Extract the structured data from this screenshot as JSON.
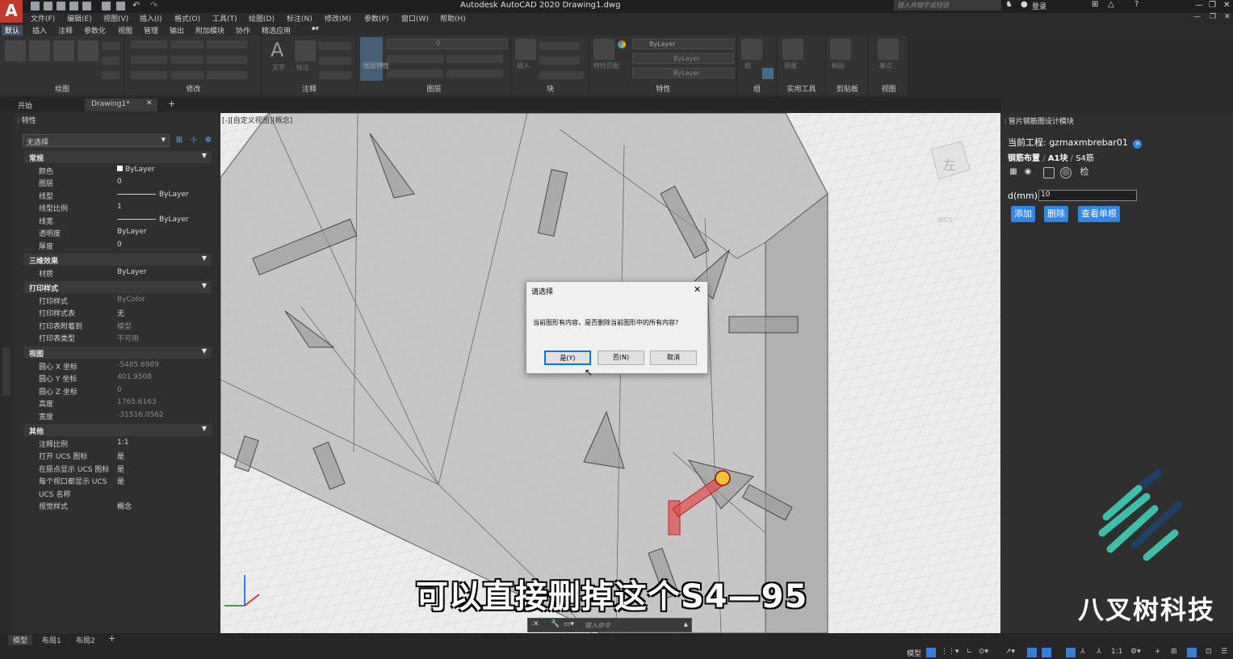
{
  "app": {
    "logo": "A",
    "title": "Autodesk AutoCAD 2020   Drawing1.dwg",
    "search_placeholder": "键入关键字或短语",
    "login": "登录"
  },
  "menus": [
    "文件(F)",
    "编辑(E)",
    "视图(V)",
    "插入(I)",
    "格式(O)",
    "工具(T)",
    "绘图(D)",
    "标注(N)",
    "修改(M)",
    "参数(P)",
    "窗口(W)",
    "帮助(H)"
  ],
  "ribbon_tabs": [
    "默认",
    "插入",
    "注释",
    "参数化",
    "视图",
    "管理",
    "输出",
    "附加模块",
    "协作",
    "精选应用"
  ],
  "ribbon_panels": [
    "绘图",
    "修改",
    "注释",
    "图层",
    "块",
    "特性",
    "组",
    "实用工具",
    "剪贴板",
    "视图"
  ],
  "ribbon_small": {
    "layer_value": "0",
    "bylayer1": "ByLayer",
    "bylayer2": "ByLayer",
    "bylayer3": "ByLayer",
    "text": "文字",
    "dim": "标注",
    "match": "特性匹配",
    "layerprop": "图层特性",
    "insert": "插入",
    "measure": "测量",
    "paste": "粘贴",
    "base": "基点",
    "group": "组"
  },
  "doc_tabs": {
    "start": "开始",
    "drawing": "Drawing1*",
    "close": "✕",
    "add": "+"
  },
  "properties": {
    "title": "特性",
    "selection": "无选择",
    "sections": {
      "general": {
        "title": "常规",
        "rows": [
          [
            "颜色",
            "ByLayer"
          ],
          [
            "图层",
            "0"
          ],
          [
            "线型",
            "ByLayer"
          ],
          [
            "线型比例",
            "1"
          ],
          [
            "线宽",
            "ByLayer"
          ],
          [
            "透明度",
            "ByLayer"
          ],
          [
            "厚度",
            "0"
          ]
        ]
      },
      "effects3d": {
        "title": "三维效果",
        "rows": [
          [
            "材质",
            "ByLayer"
          ]
        ]
      },
      "plotstyle": {
        "title": "打印样式",
        "rows": [
          [
            "打印样式",
            "ByColor"
          ],
          [
            "打印样式表",
            "无"
          ],
          [
            "打印表附着到",
            "模型"
          ],
          [
            "打印表类型",
            "不可用"
          ]
        ]
      },
      "view": {
        "title": "视图",
        "rows": [
          [
            "圆心 X 坐标",
            "-5485.6989"
          ],
          [
            "圆心 Y 坐标",
            "401.9508"
          ],
          [
            "圆心 Z 坐标",
            "0"
          ],
          [
            "高度",
            "1765.6163"
          ],
          [
            "宽度",
            "-31516.0562"
          ]
        ]
      },
      "misc": {
        "title": "其他",
        "rows": [
          [
            "注释比例",
            "1:1"
          ],
          [
            "打开 UCS 图标",
            "是"
          ],
          [
            "在原点显示 UCS 图标",
            "是"
          ],
          [
            "每个视口都显示 UCS",
            "是"
          ],
          [
            "UCS 名称",
            ""
          ],
          [
            "视觉样式",
            "概念"
          ]
        ]
      }
    }
  },
  "viewport": {
    "label": "[-][自定义视图][概念]",
    "viewcube": "左",
    "wcs": "WCS"
  },
  "right_panel": {
    "title": "管片钢筋图设计模块",
    "project_label": "当前工程: gzmaxmbrebar01",
    "crumbs": [
      "钢筋布置",
      "A1块",
      "S4筋"
    ],
    "check": "检",
    "d_label": "d(mm)",
    "d_value": "10",
    "buttons": [
      "添加",
      "删除",
      "查看单根"
    ]
  },
  "dialog": {
    "title": "请选择",
    "message": "当前图形有内容，是否删除当前图形中的所有内容?",
    "yes": "是(Y)",
    "no": "否(N)",
    "cancel": "取消"
  },
  "command": {
    "placeholder": "键入命令"
  },
  "subtitle": "可以直接删掉这个S4—95",
  "brand": "八叉树科技",
  "layout_tabs": [
    "模型",
    "布局1",
    "布局2",
    "+"
  ],
  "status": {
    "model": "模型",
    "scale": "1:1"
  },
  "colors": {
    "accent": "#2f87e6",
    "brand_teal": "#3ebfa9",
    "brand_navy": "#1f3f63",
    "rebar_highlight": "#e24b4b"
  }
}
